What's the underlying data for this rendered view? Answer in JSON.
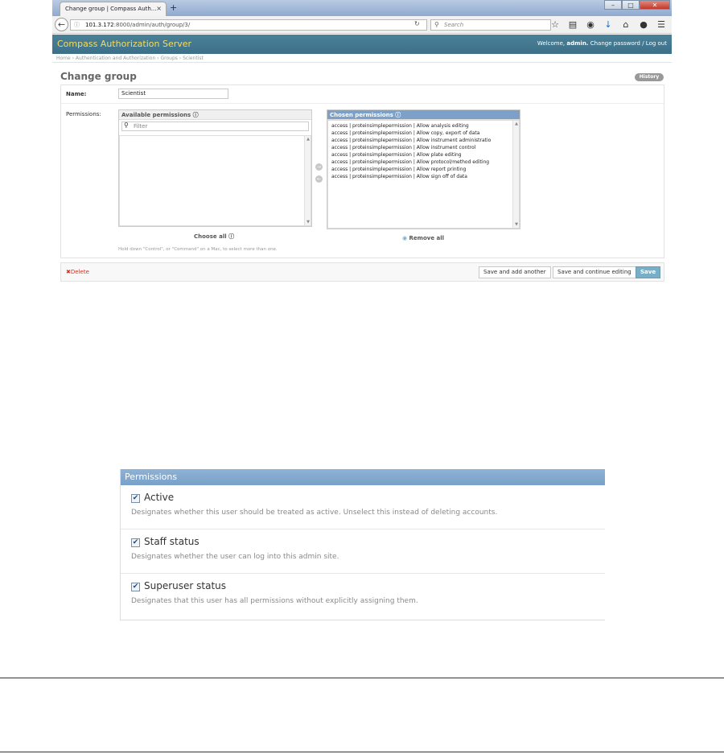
{
  "browser": {
    "tab_title": "Change group | Compass Auth...",
    "tab_close": "×",
    "new_tab": "+",
    "win_minimize": "–",
    "win_restore": "□",
    "win_close": "✕",
    "url_prefix": "101.3.172",
    "url_rest": ":8000/admin/auth/group/3/",
    "search_placeholder": "Search",
    "icons": [
      "star-icon",
      "clipboard-icon",
      "pocket-icon",
      "download-icon",
      "home-icon",
      "chat-icon",
      "menu-icon"
    ]
  },
  "admin": {
    "brand": "Compass Authorization Server",
    "welcome": "Welcome,",
    "user": "admin.",
    "change_password": "Change password",
    "sep": "/",
    "logout": "Log out",
    "breadcrumbs": "Home › Authentication and Authorization › Groups › Scientist",
    "page_title": "Change group",
    "history_label": "History"
  },
  "form": {
    "name_label": "Name:",
    "name_value": "Scientist",
    "permissions_label": "Permissions:",
    "available_title": "Available permissions",
    "filter_placeholder": "Filter",
    "chosen_title": "Chosen permissions",
    "chosen": [
      "access | proteinsimplepermission | Allow analysis editing",
      "access | proteinsimplepermission | Allow copy, export of data",
      "access | proteinsimplepermission | Allow instrument administratio",
      "access | proteinsimplepermission | Allow instrument control",
      "access | proteinsimplepermission | Allow plate editing",
      "access | proteinsimplepermission | Allow protocol/method editing",
      "access | proteinsimplepermission | Allow report printing",
      "access | proteinsimplepermission | Allow sign off of data"
    ],
    "choose_all": "Choose all",
    "remove_all": "Remove all",
    "help_text": "Hold down \"Control\", or \"Command\" on a Mac, to select more than one."
  },
  "submit": {
    "delete": "Delete",
    "save_add": "Save and add another",
    "save_continue": "Save and continue editing",
    "save": "Save"
  },
  "permissions_panel": {
    "title": "Permissions",
    "items": [
      {
        "label": "Active",
        "help": "Designates whether this user should be treated as active. Unselect this instead of deleting accounts.",
        "checked": true
      },
      {
        "label": "Staff status",
        "help": "Designates whether the user can log into this admin site.",
        "checked": true
      },
      {
        "label": "Superuser status",
        "help": "Designates that this user has all permissions without explicitly assigning them.",
        "checked": true
      }
    ]
  }
}
